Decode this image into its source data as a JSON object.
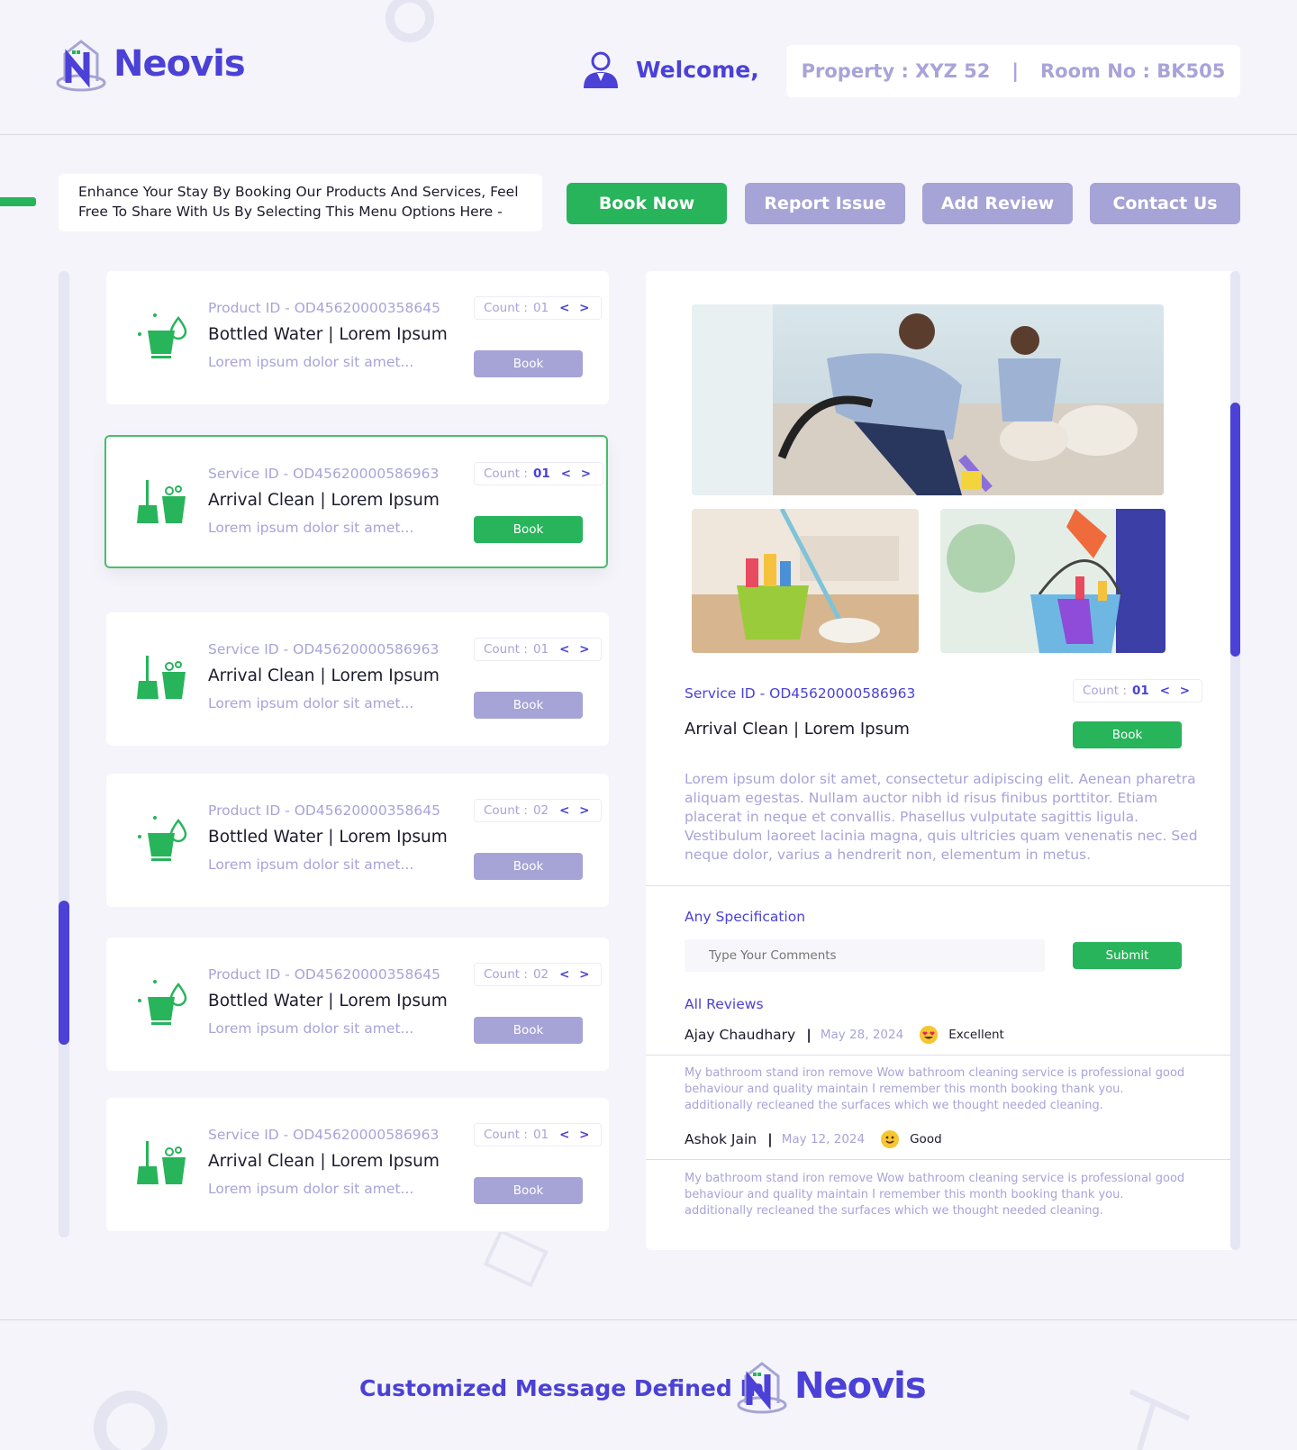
{
  "brand": {
    "name": "Neovis"
  },
  "header": {
    "welcome": "Welcome,",
    "property": "Property : XYZ 52",
    "separator": "|",
    "room": "Room No : BK505"
  },
  "intro": {
    "line1": "Enhance Your Stay By Booking Our Products And Services, Feel",
    "line2": "Free To Share With Us By Selecting This Menu Options Here -"
  },
  "nav": {
    "book_now": "Book Now",
    "report_issue": "Report Issue",
    "add_review": "Add Review",
    "contact_us": "Contact Us"
  },
  "cards": [
    {
      "id": "Product ID - OD45620000358645",
      "title": "Bottled Water | Lorem Ipsum",
      "desc": "Lorem ipsum dolor sit amet...",
      "count_label": "Count :",
      "count": "01",
      "arrows": "< >",
      "book": "Book",
      "icon": "bucket-water-icon"
    },
    {
      "id": "Service ID - OD45620000586963",
      "title": "Arrival Clean | Lorem Ipsum",
      "desc": "Lorem ipsum dolor sit amet...",
      "count_label": "Count :",
      "count": "01",
      "arrows": "< >",
      "book": "Book",
      "icon": "broom-bucket-icon"
    },
    {
      "id": "Service ID - OD45620000586963",
      "title": "Arrival Clean | Lorem Ipsum",
      "desc": "Lorem ipsum dolor sit amet...",
      "count_label": "Count :",
      "count": "01",
      "arrows": "< >",
      "book": "Book",
      "icon": "broom-bucket-icon"
    },
    {
      "id": "Product ID - OD45620000358645",
      "title": "Bottled Water | Lorem Ipsum",
      "desc": "Lorem ipsum dolor sit amet...",
      "count_label": "Count :",
      "count": "02",
      "arrows": "< >",
      "book": "Book",
      "icon": "bucket-water-icon"
    },
    {
      "id": "Product ID - OD45620000358645",
      "title": "Bottled Water | Lorem Ipsum",
      "desc": "Lorem ipsum dolor sit amet...",
      "count_label": "Count :",
      "count": "02",
      "arrows": "< >",
      "book": "Book",
      "icon": "bucket-water-icon"
    },
    {
      "id": "Service ID - OD45620000586963",
      "title": "Arrival Clean | Lorem Ipsum",
      "desc": "Lorem ipsum dolor sit amet...",
      "count_label": "Count :",
      "count": "01",
      "arrows": "< >",
      "book": "Book",
      "icon": "broom-bucket-icon"
    }
  ],
  "detail": {
    "id": "Service ID - OD45620000586963",
    "title": "Arrival Clean | Lorem Ipsum",
    "count_label": "Count :",
    "count": "01",
    "arrows": "< >",
    "book": "Book",
    "description": "Lorem ipsum dolor sit amet, consectetur adipiscing elit. Aenean pharetra aliquam egestas. Nullam auctor nibh id risus finibus porttitor. Etiam placerat in neque et convallis. Phasellus vulputate sagittis ligula. Vestibulum laoreet lacinia magna,  quis ultricies quam venenatis nec. Sed neque dolor, varius a hendrerit  non, elementum in metus.",
    "spec_label": "Any Specification",
    "comment_placeholder": "Type Your Comments",
    "submit": "Submit",
    "reviews_label": "All Reviews",
    "reviews": [
      {
        "name": "Ajay Chaudhary",
        "sep": "|",
        "date": "May 28, 2024",
        "rating": "Excellent",
        "emoji": "heart-eyes-emoji",
        "text": "My bathroom stand iron remove Wow  bathroom cleaning service is professional good behaviour and quality  maintain I remember this month booking thank you. additionally reclеaned the surfaces which we thought needed cleaning."
      },
      {
        "name": "Ashok Jain",
        "sep": "|",
        "date": "May 12, 2024",
        "rating": "Good",
        "emoji": "smile-emoji",
        "text": "My bathroom stand iron remove Wow  bathroom cleaning service is professional good behaviour and quality  maintain I remember this month booking thank you. additionally reclеaned the surfaces which we thought needed cleaning."
      }
    ]
  },
  "footer": {
    "message": "Customized Message Defined In"
  },
  "colors": {
    "primary": "#4b41d6",
    "accent_green": "#27b45a",
    "muted_purple": "#a6a3d6",
    "muted_text": "#a8a3d8",
    "background": "#f4f4fa"
  }
}
